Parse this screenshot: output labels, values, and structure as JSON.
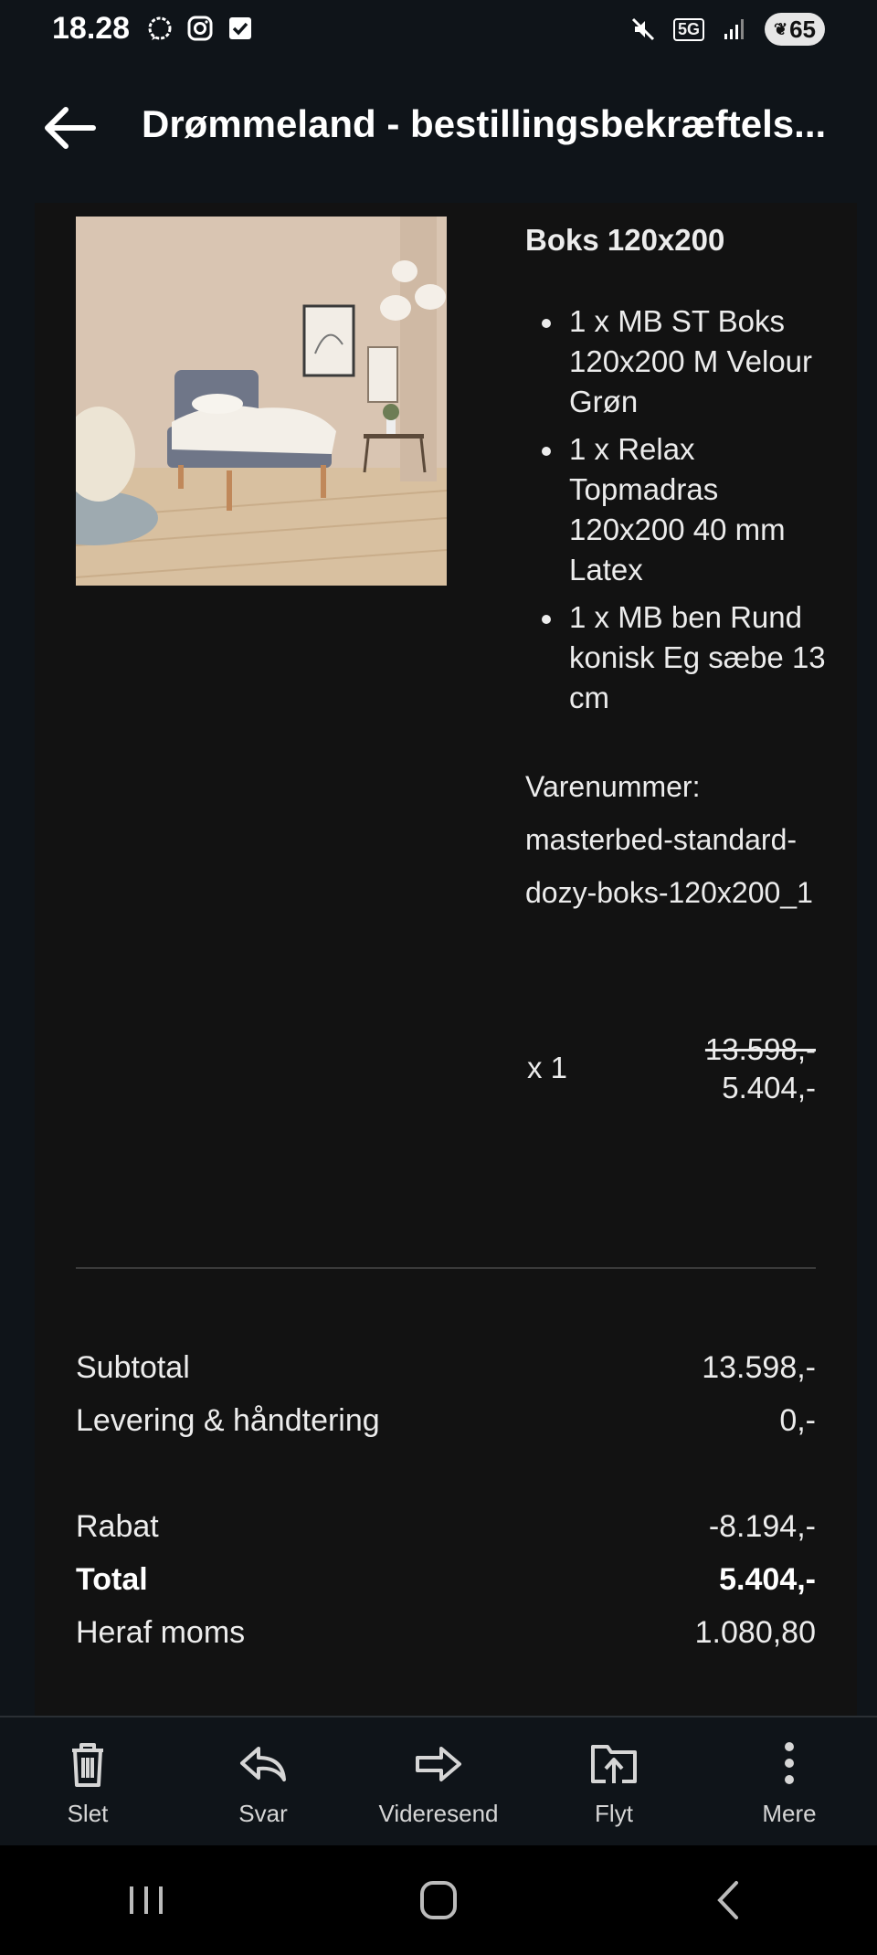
{
  "status_bar": {
    "time": "18.28",
    "network": "5G",
    "battery": "65",
    "icons": [
      "chat-bubble-icon",
      "instagram-icon",
      "checkbox-icon",
      "mute-icon",
      "signal-icon",
      "battery-icon"
    ]
  },
  "header": {
    "title": "Drømmeland - bestillingsbekræftels..."
  },
  "product": {
    "title": "Boks 120x200",
    "items": [
      "1 x MB ST Boks 120x200 M Velour Grøn",
      "1 x Relax Topmadras 120x200 40 mm Latex",
      "1 x MB ben Rund konisk Eg sæbe 13 cm"
    ],
    "sku": "Varenummer: masterbed-standard-dozy-boks-120x200_1",
    "quantity": "x 1",
    "old_price": "13.598,-",
    "new_price": "5.404,-"
  },
  "summary": {
    "subtotal_label": "Subtotal",
    "subtotal_value": "13.598,-",
    "delivery_label": "Levering & håndtering",
    "delivery_value": "0,-",
    "discount_label": "Rabat",
    "discount_value": "-8.194,-",
    "total_label": "Total",
    "total_value": "5.404,-",
    "vat_label": "Heraf moms",
    "vat_value": "1.080,80"
  },
  "actions": {
    "delete": "Slet",
    "reply": "Svar",
    "forward": "Videresend",
    "move": "Flyt",
    "more": "Mere"
  },
  "colors": {
    "background": "#0f1419",
    "card": "#121212",
    "text": "#ececec"
  }
}
